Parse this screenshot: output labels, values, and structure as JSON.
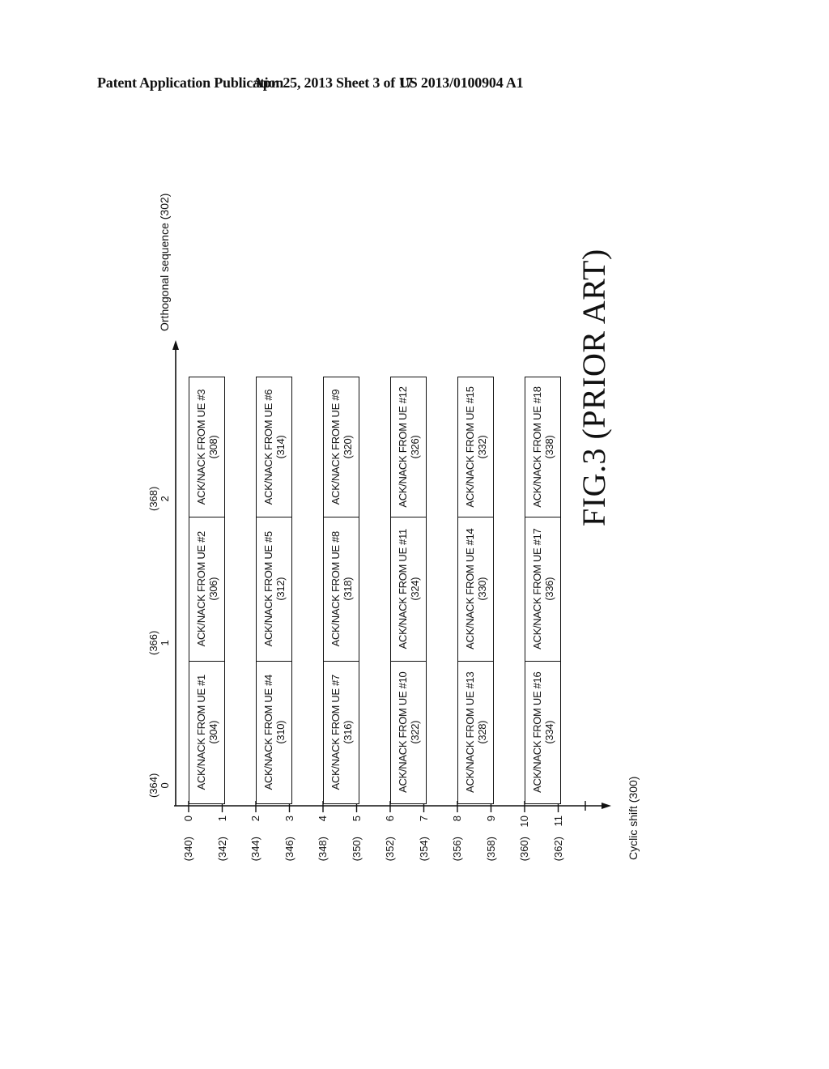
{
  "header": {
    "left": "Patent Application Publication",
    "middle": "Apr. 25, 2013  Sheet 3 of 17",
    "right": "US 2013/0100904 A1"
  },
  "figure": {
    "caption": "FIG.3 (PRIOR ART)",
    "y_axis_label": "Orthogonal sequence (302)",
    "x_axis_label": "Cyclic shift (300)",
    "orthogonal_columns": [
      {
        "ref": "(364)",
        "index": "0"
      },
      {
        "ref": "(366)",
        "index": "1"
      },
      {
        "ref": "(368)",
        "index": "2"
      }
    ],
    "cyclic_shifts": [
      {
        "ref": "(340)",
        "index": "0"
      },
      {
        "ref": "(342)",
        "index": "1"
      },
      {
        "ref": "(344)",
        "index": "2"
      },
      {
        "ref": "(346)",
        "index": "3"
      },
      {
        "ref": "(348)",
        "index": "4"
      },
      {
        "ref": "(350)",
        "index": "5"
      },
      {
        "ref": "(352)",
        "index": "6"
      },
      {
        "ref": "(354)",
        "index": "7"
      },
      {
        "ref": "(356)",
        "index": "8"
      },
      {
        "ref": "(358)",
        "index": "9"
      },
      {
        "ref": "(360)",
        "index": "10"
      },
      {
        "ref": "(362)",
        "index": "11"
      }
    ],
    "rows": [
      {
        "cells": [
          {
            "label": "ACK/NACK FROM UE #1",
            "ref": "(304)"
          },
          {
            "label": "ACK/NACK FROM UE #2",
            "ref": "(306)"
          },
          {
            "label": "ACK/NACK FROM UE #3",
            "ref": "(308)"
          }
        ]
      },
      {
        "cells": [
          {
            "label": "ACK/NACK FROM UE #4",
            "ref": "(310)"
          },
          {
            "label": "ACK/NACK FROM UE #5",
            "ref": "(312)"
          },
          {
            "label": "ACK/NACK FROM UE #6",
            "ref": "(314)"
          }
        ]
      },
      {
        "cells": [
          {
            "label": "ACK/NACK FROM UE #7",
            "ref": "(316)"
          },
          {
            "label": "ACK/NACK FROM UE #8",
            "ref": "(318)"
          },
          {
            "label": "ACK/NACK FROM UE #9",
            "ref": "(320)"
          }
        ]
      },
      {
        "cells": [
          {
            "label": "ACK/NACK FROM UE #10",
            "ref": "(322)"
          },
          {
            "label": "ACK/NACK FROM UE #11",
            "ref": "(324)"
          },
          {
            "label": "ACK/NACK FROM UE #12",
            "ref": "(326)"
          }
        ]
      },
      {
        "cells": [
          {
            "label": "ACK/NACK FROM UE #13",
            "ref": "(328)"
          },
          {
            "label": "ACK/NACK FROM UE #14",
            "ref": "(330)"
          },
          {
            "label": "ACK/NACK FROM UE #15",
            "ref": "(332)"
          }
        ]
      },
      {
        "cells": [
          {
            "label": "ACK/NACK FROM UE #16",
            "ref": "(334)"
          },
          {
            "label": "ACK/NACK FROM UE #17",
            "ref": "(336)"
          },
          {
            "label": "ACK/NACK FROM UE #18",
            "ref": "(338)"
          }
        ]
      }
    ]
  }
}
